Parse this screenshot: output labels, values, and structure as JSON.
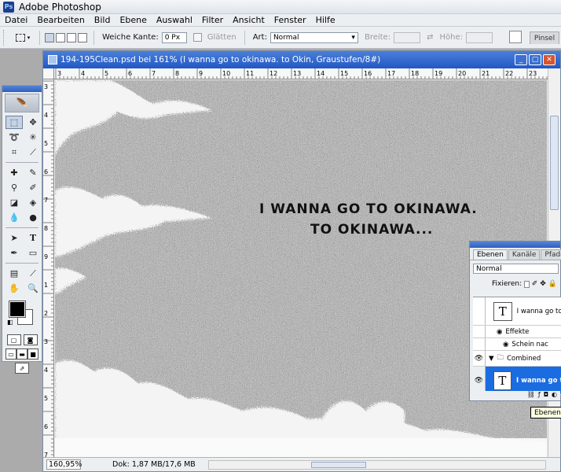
{
  "app": {
    "title": "Adobe Photoshop",
    "icon": "ps-app-icon"
  },
  "menu": [
    "Datei",
    "Bearbeiten",
    "Bild",
    "Ebene",
    "Auswahl",
    "Filter",
    "Ansicht",
    "Fenster",
    "Hilfe"
  ],
  "options": {
    "soft_edge_label": "Weiche Kante:",
    "soft_edge_value": "0 Px",
    "smooth_label": "Glätten",
    "style_label": "Art:",
    "style_value": "Normal",
    "width_label": "Breite:",
    "height_label": "Höhe:",
    "brush_tab": "Pinsel"
  },
  "document": {
    "title": "194-195Clean.psd bei 161% (I wanna go to okinawa. to Okin, Graustufen/8#)",
    "zoom": "160,95%",
    "doc_info": "Dok: 1,87 MB/17,6 MB",
    "ruler_top": [
      "3",
      "4",
      "5",
      "6",
      "7",
      "8",
      "9",
      "10",
      "11",
      "12",
      "13",
      "14",
      "15",
      "16",
      "17",
      "18",
      "19",
      "20",
      "21",
      "22",
      "23"
    ],
    "ruler_left": [
      "3",
      "4",
      "5",
      "6",
      "7",
      "8",
      "9",
      "1",
      "2",
      "3",
      "4",
      "5",
      "6",
      "7"
    ]
  },
  "canvas_text": {
    "line1": "I WANNA GO TO OKINAWA.",
    "line2": "TO OKINAWA..."
  },
  "layers_panel": {
    "tabs": [
      "Ebenen",
      "Kanäle",
      "Pfade"
    ],
    "blend_mode": "Normal",
    "lock_label": "Fixieren:",
    "layers": [
      {
        "name": "I wanna go to",
        "type": "text",
        "visible": false,
        "selected": false
      },
      {
        "name": "Effekte",
        "type": "effects",
        "visible": false,
        "selected": false
      },
      {
        "name": "Schein nac",
        "type": "effect",
        "visible": false,
        "selected": false
      },
      {
        "name": "Combined",
        "type": "group",
        "visible": true,
        "selected": false
      },
      {
        "name": "I wanna go t",
        "type": "text",
        "visible": true,
        "selected": true
      }
    ],
    "tooltip": "Ebenenst"
  },
  "colors": {
    "accent": "#2258c5",
    "selection": "#1b6ce0"
  }
}
